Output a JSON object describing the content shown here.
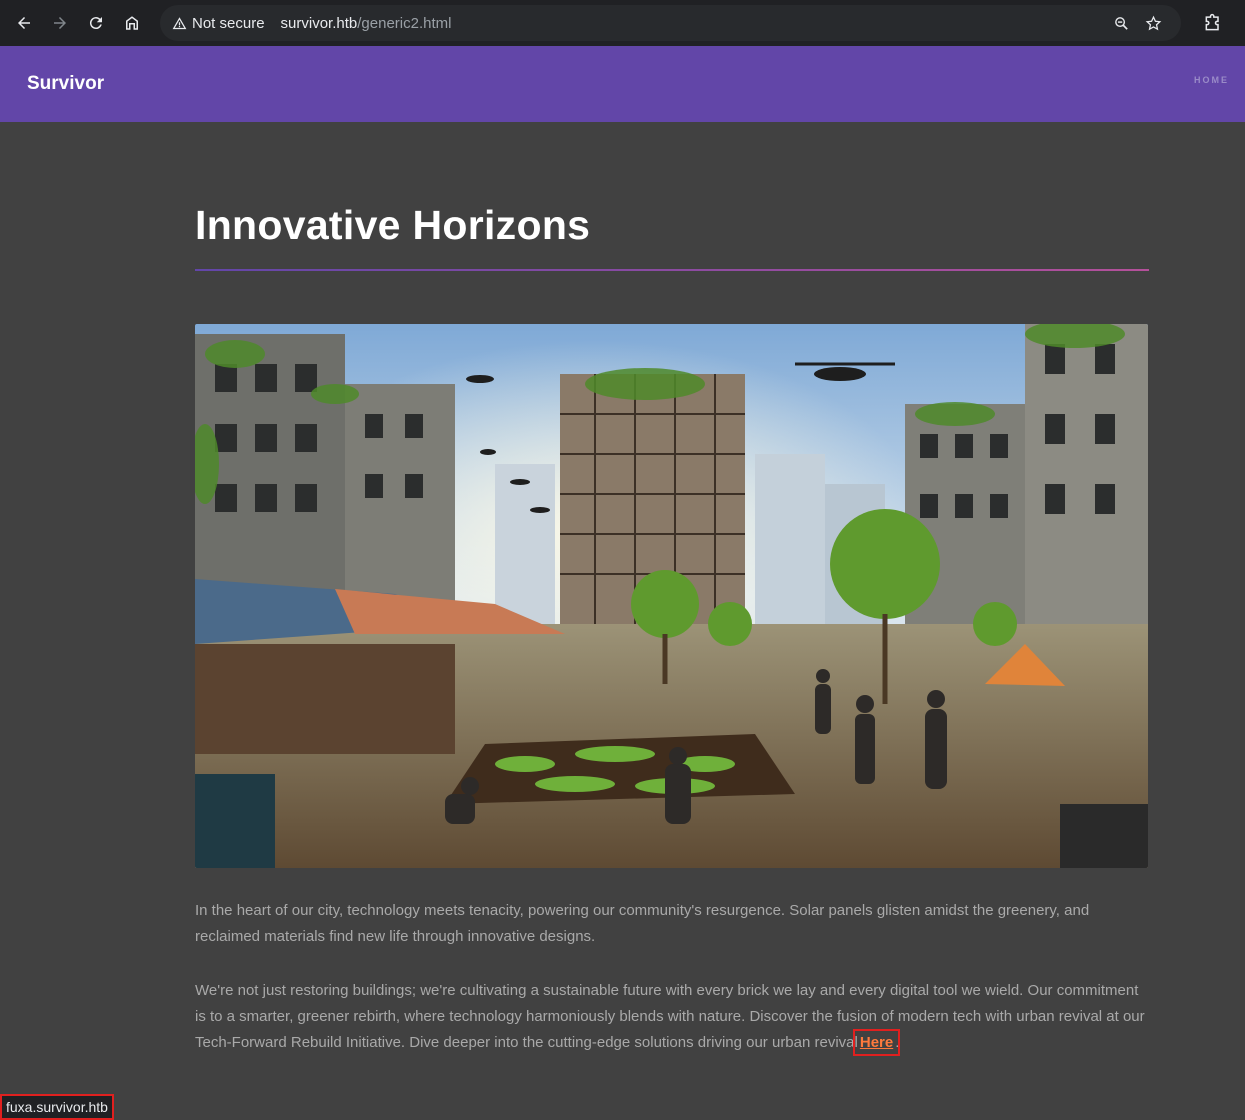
{
  "browser": {
    "security_label": "Not secure",
    "url_host": "survivor.htb",
    "url_path": "/generic2.html",
    "icons": [
      "back-icon",
      "forward-icon",
      "reload-icon",
      "home-icon",
      "warning-icon",
      "zoom-icon",
      "bookmark-star-icon",
      "extensions-icon"
    ]
  },
  "site": {
    "logo": "Survivor",
    "nav": {
      "home": "HOME"
    },
    "brand_color": "#6246a8"
  },
  "article": {
    "title": "Innovative Horizons",
    "paragraph1": "In the heart of our city, technology meets tenacity, powering our community's resurgence. Solar panels glisten amidst the greenery, and reclaimed materials find new life through innovative designs.",
    "paragraph2_text": "We're not just restoring buildings; we're cultivating a sustainable future with every brick we lay and every digital tool we wield. Our commitment is to a smarter, greener rebirth, where technology harmoniously blends with nature. Discover the fusion of modern tech with urban revival at our Tech-Forward Rebuild Initiative. Dive deeper into the cutting-edge solutions driving our urban revival",
    "link_text": "Here",
    "paragraph2_end": "."
  },
  "status_bar": {
    "hover_url": "fuxa.survivor.htb"
  }
}
